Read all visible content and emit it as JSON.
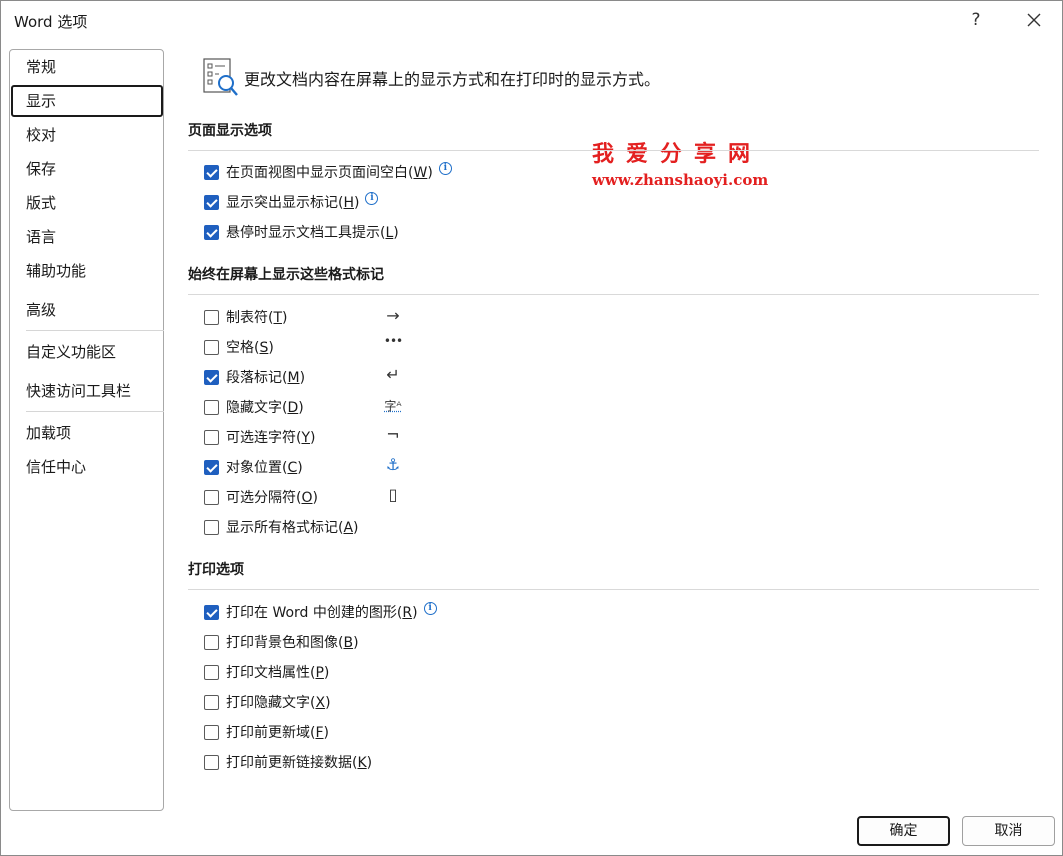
{
  "window": {
    "title": "Word 选项",
    "help": "?",
    "close_icon": "close-icon"
  },
  "sidebar": {
    "items": [
      {
        "label": "常规",
        "selected": false
      },
      {
        "label": "显示",
        "selected": true
      },
      {
        "label": "校对",
        "selected": false
      },
      {
        "label": "保存",
        "selected": false
      },
      {
        "label": "版式",
        "selected": false
      },
      {
        "label": "语言",
        "selected": false
      },
      {
        "label": "辅助功能",
        "selected": false
      },
      {
        "label": "高级",
        "selected": false
      },
      {
        "label": "自定义功能区",
        "selected": false
      },
      {
        "label": "快速访问工具栏",
        "selected": false
      },
      {
        "label": "加载项",
        "selected": false
      },
      {
        "label": "信任中心",
        "selected": false
      }
    ]
  },
  "header": {
    "text": "更改文档内容在屏幕上的显示方式和在打印时的显示方式。"
  },
  "watermark": {
    "line1": "我爱分享网",
    "line2": "www.zhanshaoyi.com"
  },
  "sections": {
    "page_display": {
      "title": "页面显示选项",
      "options": [
        {
          "label": "在页面视图中显示页面间空白",
          "key": "W",
          "checked": true,
          "info": true
        },
        {
          "label": "显示突出显示标记",
          "key": "H",
          "checked": true,
          "info": true
        },
        {
          "label": "悬停时显示文档工具提示",
          "key": "L",
          "checked": true,
          "info": false
        }
      ]
    },
    "format_marks": {
      "title": "始终在屏幕上显示这些格式标记",
      "options": [
        {
          "label": "制表符",
          "key": "T",
          "checked": false,
          "symbol": "→"
        },
        {
          "label": "空格",
          "key": "S",
          "checked": false,
          "symbol": "•••"
        },
        {
          "label": "段落标记",
          "key": "M",
          "checked": true,
          "symbol": "↵"
        },
        {
          "label": "隐藏文字",
          "key": "D",
          "checked": false,
          "symbol": "字ᴬ"
        },
        {
          "label": "可选连字符",
          "key": "Y",
          "checked": false,
          "symbol": "¬"
        },
        {
          "label": "对象位置",
          "key": "C",
          "checked": true,
          "symbol": "⚓"
        },
        {
          "label": "可选分隔符",
          "key": "O",
          "checked": false,
          "symbol": "▯"
        },
        {
          "label": "显示所有格式标记",
          "key": "A",
          "checked": false,
          "symbol": ""
        }
      ]
    },
    "print": {
      "title": "打印选项",
      "options": [
        {
          "label": "打印在 Word 中创建的图形",
          "key": "R",
          "checked": true,
          "info": true
        },
        {
          "label": "打印背景色和图像",
          "key": "B",
          "checked": false,
          "info": false
        },
        {
          "label": "打印文档属性",
          "key": "P",
          "checked": false,
          "info": false
        },
        {
          "label": "打印隐藏文字",
          "key": "X",
          "checked": false,
          "info": false
        },
        {
          "label": "打印前更新域",
          "key": "F",
          "checked": false,
          "info": false
        },
        {
          "label": "打印前更新链接数据",
          "key": "K",
          "checked": false,
          "info": false
        }
      ]
    }
  },
  "footer": {
    "ok": "确定",
    "cancel": "取消"
  },
  "colors": {
    "accent": "#1f5fbf",
    "watermark": "#e32020",
    "info": "#1f6fc9"
  }
}
